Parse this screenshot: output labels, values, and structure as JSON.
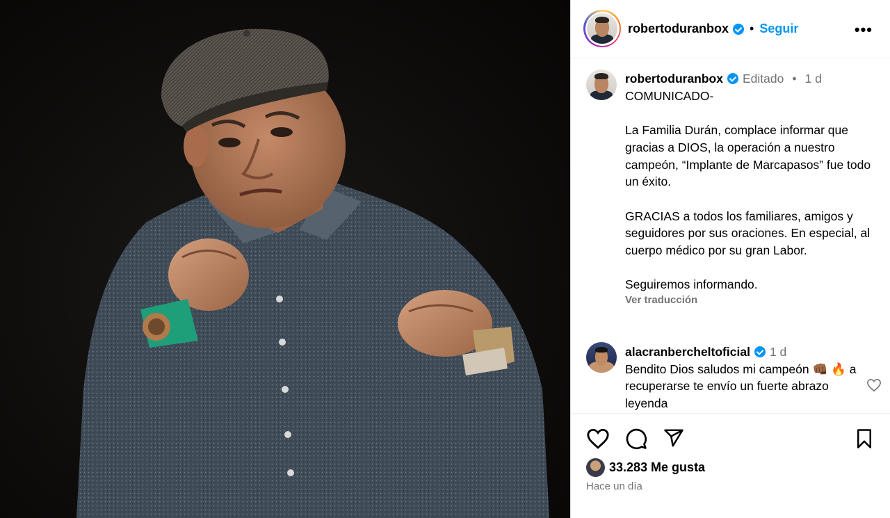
{
  "header": {
    "username": "robertoduranbox",
    "separator": "•",
    "follow_label": "Seguir",
    "more_label": "•••"
  },
  "caption": {
    "username": "robertoduranbox",
    "edited_label": "Editado",
    "separator": "•",
    "age": "1 d",
    "body": "COMUNICADO-\n\nLa Familia Durán, complace informar que gracias a DIOS, la operación a nuestro campeón, “Implante de Marcapasos” fue todo un éxito.\n\nGRACIAS a todos los familiares, amigos y seguidores por sus oraciones. En especial, al cuerpo médico por su gran Labor.\n\nSeguiremos informando.",
    "translate_label": "Ver traducción"
  },
  "comment": {
    "username": "alacranbercheltoficial",
    "age": "1 d",
    "body": "Bendito Dios saludos mi campeón 👊🏾 🔥 a recuperarse te envío un fuerte abrazo leyenda"
  },
  "footer": {
    "likes": "33.283 Me gusta",
    "time_ago": "Hace un día"
  },
  "colors": {
    "accent": "#0095f6",
    "muted": "#737373",
    "border": "#dbdbdb"
  },
  "icons": [
    "like-icon",
    "comment-icon",
    "share-icon",
    "save-icon",
    "verified-badge-icon",
    "more-options-icon"
  ]
}
